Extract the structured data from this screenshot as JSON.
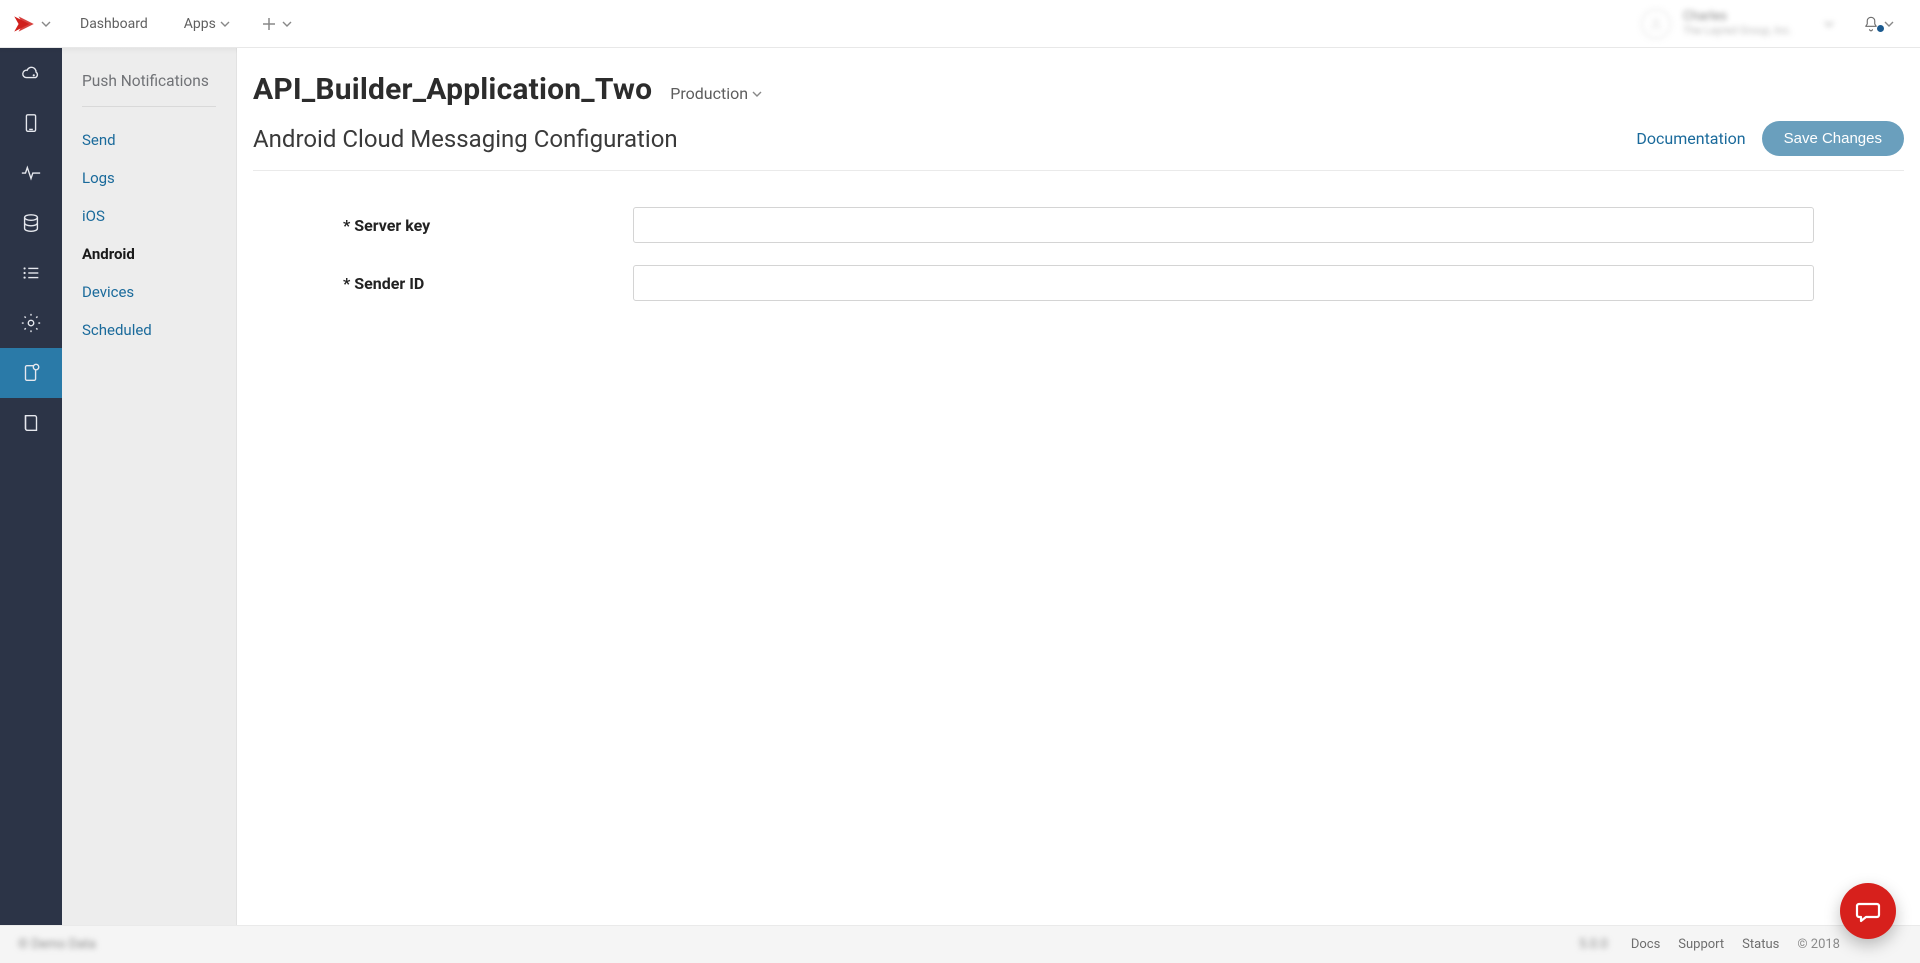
{
  "topnav": {
    "dashboard": "Dashboard",
    "apps": "Apps"
  },
  "user": {
    "name": "Charles",
    "org": "The Layred Group, Inc."
  },
  "sidebar": {
    "title": "Push Notifications",
    "items": [
      {
        "label": "Send"
      },
      {
        "label": "Logs"
      },
      {
        "label": "iOS"
      },
      {
        "label": "Android"
      },
      {
        "label": "Devices"
      },
      {
        "label": "Scheduled"
      }
    ]
  },
  "page": {
    "title": "API_Builder_Application_Two",
    "environment": "Production",
    "subtitle": "Android Cloud Messaging Configuration",
    "documentation_label": "Documentation",
    "save_label": "Save Changes"
  },
  "form": {
    "server_key_label": "Server key",
    "sender_id_label": "Sender ID",
    "server_key_value": "",
    "sender_id_value": ""
  },
  "footer": {
    "left": "© Demo Data",
    "version": "5.0.0",
    "docs": "Docs",
    "support": "Support",
    "status": "Status",
    "copyright": "© 2018"
  }
}
